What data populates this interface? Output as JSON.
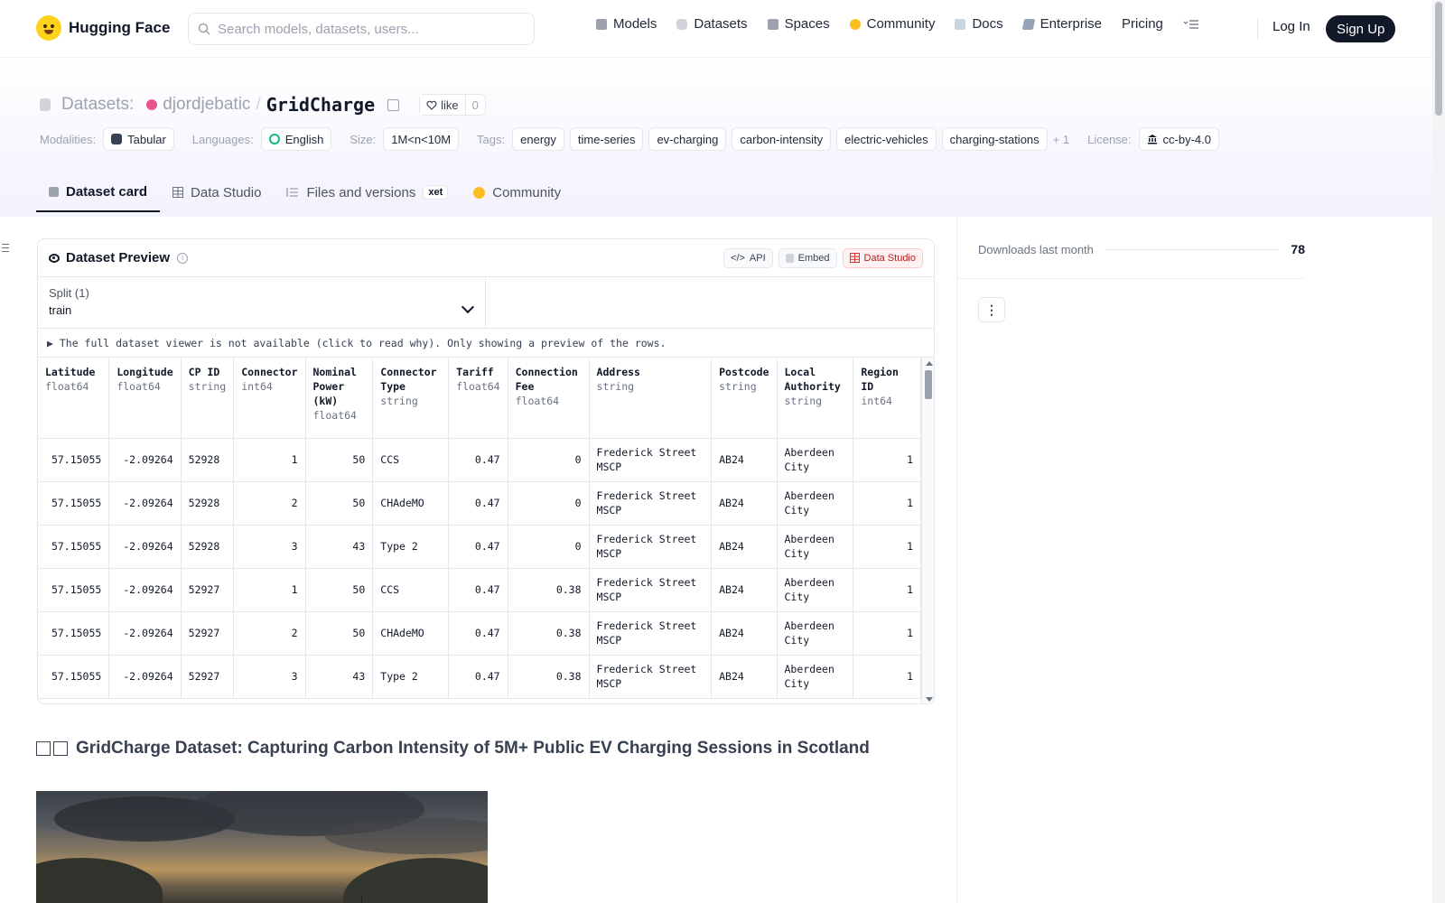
{
  "nav": {
    "brand": "Hugging Face",
    "search_placeholder": "Search models, datasets, users...",
    "links": [
      {
        "label": "Models",
        "icon": "models-icon"
      },
      {
        "label": "Datasets",
        "icon": "datasets-icon"
      },
      {
        "label": "Spaces",
        "icon": "spaces-icon"
      },
      {
        "label": "Community",
        "icon": "community-icon"
      },
      {
        "label": "Docs",
        "icon": "docs-icon"
      },
      {
        "label": "Enterprise",
        "icon": "enterprise-icon"
      },
      {
        "label": "Pricing",
        "icon": ""
      }
    ],
    "login": "Log In",
    "signup": "Sign Up"
  },
  "repo": {
    "section_label": "Datasets:",
    "owner": "djordjebatic",
    "separator": "/",
    "name": "GridCharge",
    "like_label": "like",
    "like_count": "0"
  },
  "meta": {
    "modalities_label": "Modalities:",
    "modality": "Tabular",
    "languages_label": "Languages:",
    "language": "English",
    "size_label": "Size:",
    "size": "1M<n<10M",
    "tags_label": "Tags:",
    "tags": [
      "energy",
      "time-series",
      "ev-charging",
      "carbon-intensity",
      "electric-vehicles",
      "charging-stations"
    ],
    "more_tags": "+ 1",
    "license_label": "License:",
    "license": "cc-by-4.0"
  },
  "tabs": [
    {
      "label": "Dataset card",
      "active": true
    },
    {
      "label": "Data Studio",
      "active": false
    },
    {
      "label": "Files and versions",
      "active": false,
      "badge": "xet"
    },
    {
      "label": "Community",
      "active": false
    }
  ],
  "preview": {
    "title": "Dataset Preview",
    "buttons": {
      "api": "API",
      "embed": "Embed",
      "studio": "Data Studio"
    },
    "split_label": "Split (1)",
    "split_value": "train",
    "notice": "▶ The full dataset viewer is not available (click to read why). Only showing a preview of the rows.",
    "columns": [
      {
        "name": "Latitude",
        "dtype": "float64"
      },
      {
        "name": "Longitude",
        "dtype": "float64"
      },
      {
        "name": "CP ID",
        "dtype": "string"
      },
      {
        "name": "Connector",
        "dtype": "int64"
      },
      {
        "name": "Nominal Power (kW)",
        "dtype": "float64"
      },
      {
        "name": "Connector Type",
        "dtype": "string"
      },
      {
        "name": "Tariff",
        "dtype": "float64"
      },
      {
        "name": "Connection Fee",
        "dtype": "float64"
      },
      {
        "name": "Address",
        "dtype": "string"
      },
      {
        "name": "Postcode",
        "dtype": "string"
      },
      {
        "name": "Local Authority",
        "dtype": "string"
      },
      {
        "name": "Region ID",
        "dtype": "int64"
      }
    ],
    "rows": [
      [
        "57.15055",
        "-2.09264",
        "52928",
        "1",
        "50",
        "CCS",
        "0.47",
        "0",
        "Frederick Street MSCP",
        "AB24",
        "Aberdeen City",
        "1"
      ],
      [
        "57.15055",
        "-2.09264",
        "52928",
        "2",
        "50",
        "CHAdeMO",
        "0.47",
        "0",
        "Frederick Street MSCP",
        "AB24",
        "Aberdeen City",
        "1"
      ],
      [
        "57.15055",
        "-2.09264",
        "52928",
        "3",
        "43",
        "Type 2",
        "0.47",
        "0",
        "Frederick Street MSCP",
        "AB24",
        "Aberdeen City",
        "1"
      ],
      [
        "57.15055",
        "-2.09264",
        "52927",
        "1",
        "50",
        "CCS",
        "0.47",
        "0.38",
        "Frederick Street MSCP",
        "AB24",
        "Aberdeen City",
        "1"
      ],
      [
        "57.15055",
        "-2.09264",
        "52927",
        "2",
        "50",
        "CHAdeMO",
        "0.47",
        "0.38",
        "Frederick Street MSCP",
        "AB24",
        "Aberdeen City",
        "1"
      ],
      [
        "57.15055",
        "-2.09264",
        "52927",
        "3",
        "43",
        "Type 2",
        "0.47",
        "0.38",
        "Frederick Street MSCP",
        "AB24",
        "Aberdeen City",
        "1"
      ]
    ]
  },
  "card": {
    "heading": "GridCharge Dataset: Capturing Carbon Intensity of 5M+ Public EV Charging Sessions in Scotland"
  },
  "sidebar": {
    "downloads_label": "Downloads last month",
    "downloads_value": "78",
    "more_button": "⋮"
  },
  "colors": {
    "accent_dark": "#111827",
    "tab_band": "#f4f2fd",
    "studio_red": "#b91c1c"
  }
}
